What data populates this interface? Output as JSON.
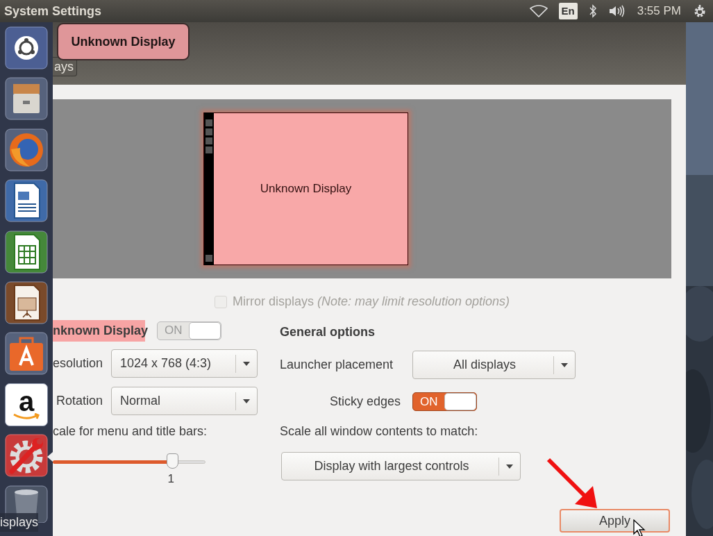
{
  "top_panel": {
    "title": "System Settings",
    "keyboard_layout": "En",
    "clock": "3:55 PM"
  },
  "launcher": {
    "items": [
      {
        "kind": "ubuntu",
        "selected": false
      },
      {
        "kind": "files",
        "selected": false
      },
      {
        "kind": "browser",
        "selected": false
      },
      {
        "kind": "writer",
        "selected": false
      },
      {
        "kind": "calc",
        "selected": false
      },
      {
        "kind": "impress",
        "selected": false
      },
      {
        "kind": "software",
        "selected": false
      },
      {
        "kind": "amazon",
        "glyph": "a",
        "selected": false
      },
      {
        "kind": "settings",
        "selected": true
      },
      {
        "kind": "trash",
        "selected": false
      }
    ],
    "underlying_text": "isplays"
  },
  "window": {
    "back_button": "ays",
    "tooltip": "Unknown Display",
    "preview": {
      "label": "Unknown Display"
    },
    "mirror": {
      "label": "Mirror displays *(Note: may limit resolution options)*",
      "checked": false,
      "disabled": true
    },
    "display": {
      "name": "nknown Display",
      "switch": {
        "label": "ON",
        "on": true,
        "disabled": true
      },
      "fields": [
        {
          "label": "esolution",
          "value": "1024 x 768 (4:3)"
        },
        {
          "label": "Rotation",
          "value": "Normal"
        }
      ],
      "scale_label": "cale for menu and title bars:",
      "scale": {
        "level": 0.78,
        "reading": "1"
      }
    },
    "general": {
      "title": "General options",
      "launcher_placement": {
        "label": "Launcher placement",
        "value": "All displays"
      },
      "sticky_edges": {
        "label": "Sticky edges",
        "switch": {
          "label": "ON",
          "on": true,
          "disabled": false
        }
      },
      "scale_label": "Scale all window contents to match:",
      "scale_value": "Display with largest controls"
    },
    "apply_button": {
      "label": "Apply",
      "focused": true
    }
  }
}
